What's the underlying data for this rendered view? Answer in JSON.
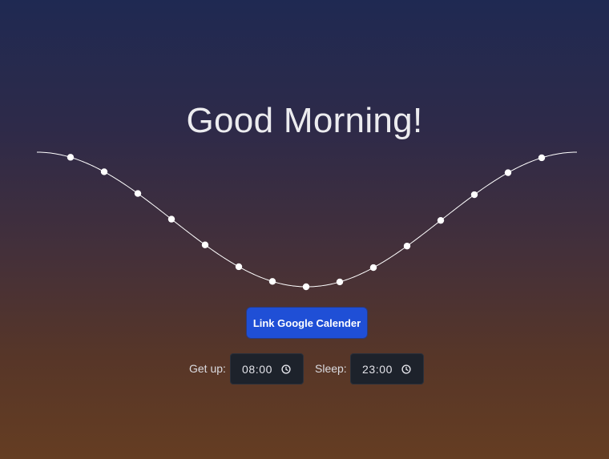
{
  "header": {
    "title": "Good Morning!"
  },
  "actions": {
    "link_calendar_label": "Link Google Calender"
  },
  "schedule": {
    "getup_label": "Get up:",
    "getup_value": "08:00",
    "sleep_label": "Sleep:",
    "sleep_value": "23:00"
  },
  "icons": {
    "time_picker": "clock-icon"
  },
  "colors": {
    "accent_button": "#1f4fd6",
    "input_bg": "#1d222b",
    "curve": "#ffffff"
  }
}
